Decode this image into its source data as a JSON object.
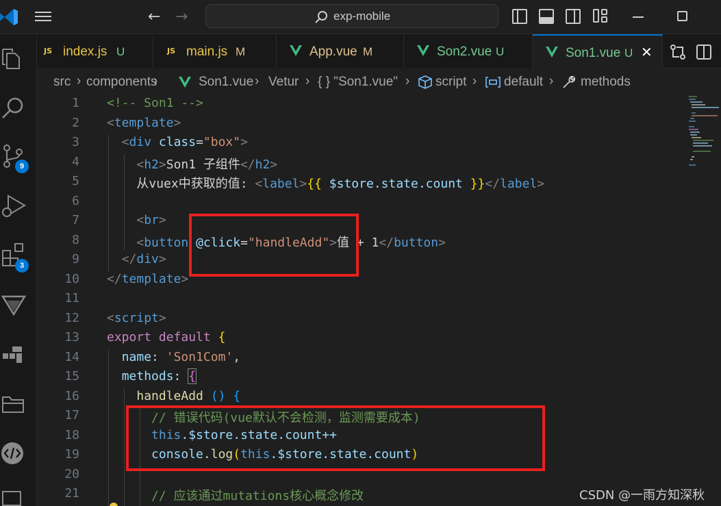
{
  "titlebar": {
    "search_text": "exp-mobile"
  },
  "activity": {
    "source_control_badge": "9",
    "extensions_badge": "3"
  },
  "tabs": [
    {
      "icon": "js",
      "label": "index.js",
      "status": "U"
    },
    {
      "icon": "js",
      "label": "main.js",
      "status": "M"
    },
    {
      "icon": "vue",
      "label": "App.vue",
      "status": "M"
    },
    {
      "icon": "vue",
      "label": "Son2.vue",
      "status": "U"
    },
    {
      "icon": "vue",
      "label": "Son1.vue",
      "status": "U"
    }
  ],
  "breadcrumb": [
    "src",
    "components",
    "Son1.vue",
    "Vetur",
    "{ } \"Son1.vue\"",
    "script",
    "default",
    "methods"
  ],
  "editor": {
    "line_numbers": [
      "1",
      "2",
      "3",
      "4",
      "5",
      "6",
      "7",
      "8",
      "9",
      "10",
      "11",
      "12",
      "13",
      "14",
      "15",
      "16",
      "17",
      "18",
      "19",
      "20",
      "21"
    ],
    "line1": "<!-- Son1 -->",
    "l2_tag": "template",
    "l3_tag": "div",
    "l3_attr": "class",
    "l3_val": "\"box\"",
    "l4_tag": "h2",
    "l4_text": "Son1 子组件",
    "l5_text": "从vuex中获取的值: ",
    "l5_tag": "label",
    "l5_expr": "$store.state.count",
    "l7_tag": "br",
    "l8_tag": "button",
    "l8_attr": "@click",
    "l8_val": "\"handleAdd\"",
    "l8_text": "值 + 1",
    "l9_tag": "div",
    "l10_tag": "template",
    "l12_tag": "script",
    "l13_kw1": "export",
    "l13_kw2": "default",
    "l14_key": "name",
    "l14_val": "'Son1Com'",
    "l15_key": "methods",
    "l16_fn": "handleAdd",
    "l17_comment": "// 错误代码(vue默认不会检测，监测需要成本)",
    "l18_this": "this",
    "l18_rest": ".$store.state.count++",
    "l19_console": "console",
    "l19_log": "log",
    "l19_this": "this",
    "l19_rest": ".$store.state.count",
    "l21_comment": "// 应该通过mutations核心概念修改"
  },
  "watermark": "CSDN @一雨方知深秋",
  "colors": {
    "highlight_box": "#e8201f",
    "accent": "#0078d4"
  }
}
